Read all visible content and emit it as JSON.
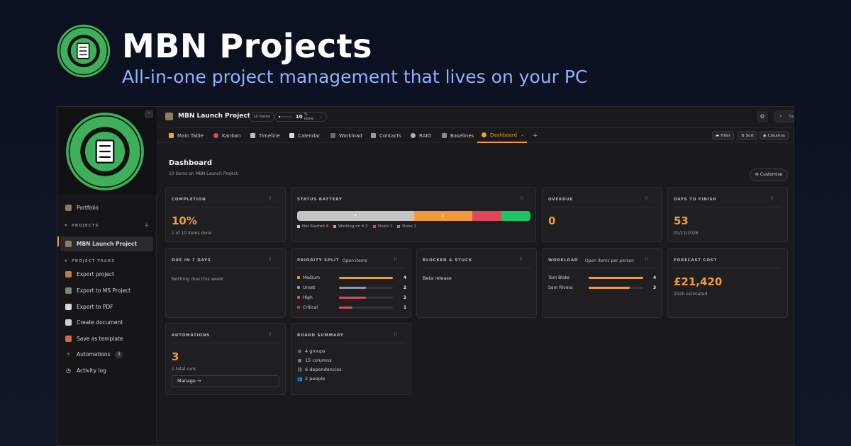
{
  "hero": {
    "title": "MBN Projects",
    "subtitle": "All-in-one project management that lives on your PC"
  },
  "colors": {
    "accent": "#f29a38",
    "not_started": "#c4c4c4",
    "working": "#f29a38",
    "stuck": "#e0475a",
    "done": "#1fc36a",
    "unset": "#8f9aa6",
    "logo_green": "#3fb05a"
  },
  "sidebar": {
    "portfolio": "Portfolio",
    "projects_heading": "PROJECTS",
    "projects": [
      "MBN Launch Project"
    ],
    "tasks_heading": "PROJECT TASKS",
    "tasks": [
      {
        "label": "Export project",
        "icon": "briefcase-icon"
      },
      {
        "label": "Export to MS Project",
        "icon": "chart-icon"
      },
      {
        "label": "Export to PDF",
        "icon": "document-icon"
      },
      {
        "label": "Create document",
        "icon": "file-plus-icon"
      },
      {
        "label": "Save as template",
        "icon": "template-icon"
      },
      {
        "label": "Automations",
        "icon": "lightning-icon",
        "badge": "3"
      },
      {
        "label": "Activity log",
        "icon": "clock-icon"
      }
    ]
  },
  "topbar": {
    "project_title": "MBN Launch Project",
    "items_count": "10 items",
    "percent_done": "10",
    "percent_done_suffix": "% done",
    "percent_value": 0.1,
    "search_placeholder": "Search items..."
  },
  "tabs": [
    {
      "label": "Main Table",
      "icon": "table-icon"
    },
    {
      "label": "Kanban",
      "icon": "pin-icon"
    },
    {
      "label": "Timeline",
      "icon": "timeline-icon"
    },
    {
      "label": "Calendar",
      "icon": "calendar-icon"
    },
    {
      "label": "Workload",
      "icon": "workload-icon"
    },
    {
      "label": "Contacts",
      "icon": "contacts-icon"
    },
    {
      "label": "RAID",
      "icon": "shield-icon"
    },
    {
      "label": "Baselines",
      "icon": "ruler-icon"
    },
    {
      "label": "Dashboard",
      "icon": "dashboard-icon",
      "active": true
    }
  ],
  "toolbar": {
    "filter": "Filter",
    "sort": "Sort",
    "columns": "Columns"
  },
  "dashboard": {
    "title": "Dashboard",
    "subtitle": "10 items on MBN Launch Project",
    "customise": "Customise",
    "completion": {
      "heading": "COMPLETION",
      "value": "10%",
      "sub": "1 of 10 items done"
    },
    "status_battery": {
      "heading": "STATUS BATTERY",
      "segments": [
        {
          "label": "Not Started",
          "count": 4,
          "bar_label": "4"
        },
        {
          "label": "Working on it",
          "count": 2,
          "bar_label": "2"
        },
        {
          "label": "Stuck",
          "count": 1,
          "bar_label": ""
        },
        {
          "label": "Done",
          "count": 1,
          "bar_label": ""
        }
      ],
      "legend": [
        "Not Started 4",
        "Working on it 2",
        "Stuck 1",
        "Done 1"
      ]
    },
    "overdue": {
      "heading": "OVERDUE",
      "value": "0"
    },
    "days_to_finish": {
      "heading": "DAYS TO FINISH",
      "value": "53",
      "sub": "01/11/2026"
    },
    "due_7": {
      "heading": "DUE IN 7 DAYS",
      "text": "Nothing due this week"
    },
    "priority_split": {
      "heading": "PRIORITY SPLIT",
      "note": "Open items",
      "rows": [
        {
          "label": "Medium",
          "count": "4",
          "value": 4
        },
        {
          "label": "Unset",
          "count": "2",
          "value": 2
        },
        {
          "label": "High",
          "count": "2",
          "value": 2
        },
        {
          "label": "Critical",
          "count": "1",
          "value": 1
        }
      ],
      "max": 4
    },
    "blocked": {
      "heading": "BLOCKED & STUCK",
      "text": "Beta release"
    },
    "workload": {
      "heading": "WORKLOAD",
      "note": "Open items per person",
      "rows": [
        {
          "name": "Tom Blake",
          "count": "4",
          "value": 4
        },
        {
          "name": "Sam Rivera",
          "count": "3",
          "value": 3
        }
      ],
      "max": 4
    },
    "forecast": {
      "heading": "FORECAST COST",
      "value": "£21,420",
      "sub": "252h estimated"
    },
    "automations": {
      "heading": "AUTOMATIONS",
      "value": "3",
      "sub": "1 total runs",
      "manage": "Manage →"
    },
    "board_summary": {
      "heading": "BOARD SUMMARY",
      "rows": [
        "4 groups",
        "15 columns",
        "6 dependencies",
        "2 people"
      ]
    }
  }
}
